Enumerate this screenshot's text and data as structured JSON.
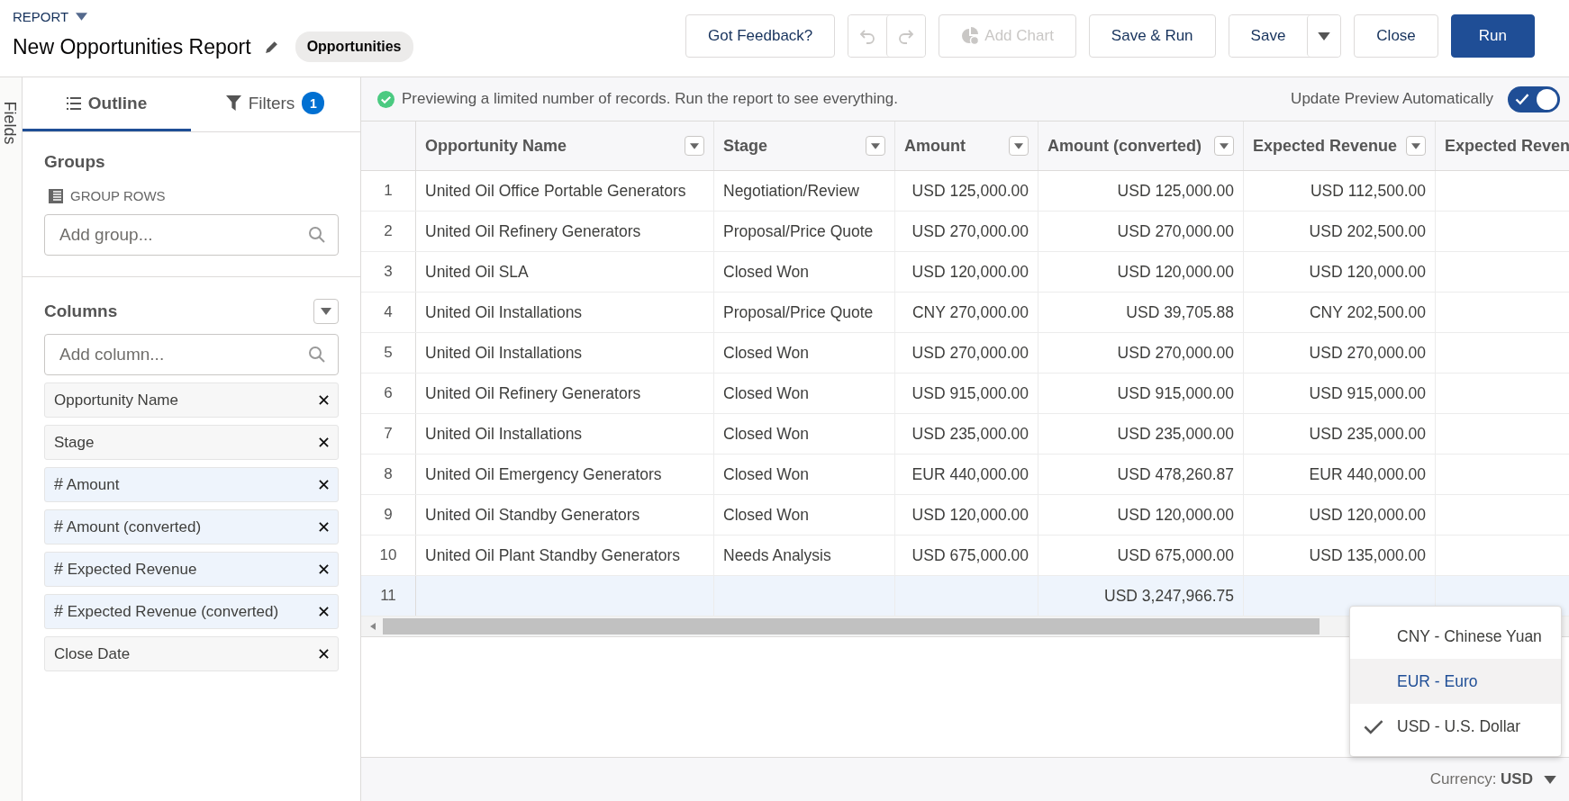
{
  "header": {
    "eyebrow": "REPORT",
    "title": "New Opportunities Report",
    "report_type": "Opportunities"
  },
  "toolbar": [
    {
      "kind": "button",
      "label": "Got Feedback?"
    },
    {
      "kind": "undo-redo",
      "disabled": true
    },
    {
      "kind": "chart",
      "label": "Add Chart",
      "disabled": true
    },
    {
      "kind": "button",
      "label": "Save & Run"
    },
    {
      "kind": "split",
      "label": "Save"
    },
    {
      "kind": "button",
      "label": "Close"
    },
    {
      "kind": "primary",
      "label": "Run"
    }
  ],
  "side_tab": "Fields",
  "panel_tabs": [
    {
      "label": "Outline",
      "selected": true
    },
    {
      "label": "Filters",
      "selected": false,
      "badge": "1"
    }
  ],
  "groups": {
    "heading": "Groups",
    "sublabel": "GROUP ROWS",
    "placeholder": "Add group..."
  },
  "columns_section": {
    "heading": "Columns",
    "placeholder": "Add column...",
    "items": [
      {
        "label": "Opportunity Name"
      },
      {
        "label": "Stage"
      },
      {
        "prefix": "#",
        "label": "Amount"
      },
      {
        "prefix": "#",
        "label": "Amount (converted)"
      },
      {
        "prefix": "#",
        "label": "Expected Revenue"
      },
      {
        "prefix": "#",
        "label": "Expected Revenue (converted)"
      },
      {
        "label": "Close Date"
      }
    ]
  },
  "preview": {
    "message": "Previewing a limited number of records. Run the report to see everything.",
    "toggle_label": "Update Preview Automatically",
    "auto_update": true
  },
  "table": {
    "columns": [
      {
        "label": "Opportunity Name"
      },
      {
        "label": "Stage"
      },
      {
        "label": "Amount"
      },
      {
        "label": "Amount (converted)"
      },
      {
        "label": "Expected Revenue"
      },
      {
        "label": "Expected Reven"
      }
    ],
    "rows": [
      {
        "number": "1",
        "total": false,
        "cells": [
          "United Oil Office Portable Generators",
          "Negotiation/Review",
          "USD 125,000.00",
          "USD 125,000.00",
          "USD 112,500.00",
          ""
        ]
      },
      {
        "number": "2",
        "total": false,
        "cells": [
          "United Oil Refinery Generators",
          "Proposal/Price Quote",
          "USD 270,000.00",
          "USD 270,000.00",
          "USD 202,500.00",
          ""
        ]
      },
      {
        "number": "3",
        "total": false,
        "cells": [
          "United Oil SLA",
          "Closed Won",
          "USD 120,000.00",
          "USD 120,000.00",
          "USD 120,000.00",
          ""
        ]
      },
      {
        "number": "4",
        "total": false,
        "cells": [
          "United Oil Installations",
          "Proposal/Price Quote",
          "CNY 270,000.00",
          "USD 39,705.88",
          "CNY 202,500.00",
          ""
        ]
      },
      {
        "number": "5",
        "total": false,
        "cells": [
          "United Oil Installations",
          "Closed Won",
          "USD 270,000.00",
          "USD 270,000.00",
          "USD 270,000.00",
          ""
        ]
      },
      {
        "number": "6",
        "total": false,
        "cells": [
          "United Oil Refinery Generators",
          "Closed Won",
          "USD 915,000.00",
          "USD 915,000.00",
          "USD 915,000.00",
          ""
        ]
      },
      {
        "number": "7",
        "total": false,
        "cells": [
          "United Oil Installations",
          "Closed Won",
          "USD 235,000.00",
          "USD 235,000.00",
          "USD 235,000.00",
          ""
        ]
      },
      {
        "number": "8",
        "total": false,
        "cells": [
          "United Oil Emergency Generators",
          "Closed Won",
          "EUR 440,000.00",
          "USD 478,260.87",
          "EUR 440,000.00",
          ""
        ]
      },
      {
        "number": "9",
        "total": false,
        "cells": [
          "United Oil Standby Generators",
          "Closed Won",
          "USD 120,000.00",
          "USD 120,000.00",
          "USD 120,000.00",
          ""
        ]
      },
      {
        "number": "10",
        "total": false,
        "cells": [
          "United Oil Plant Standby Generators",
          "Needs Analysis",
          "USD 675,000.00",
          "USD 675,000.00",
          "USD 135,000.00",
          ""
        ]
      },
      {
        "number": "11",
        "total": true,
        "cells": [
          "",
          "",
          "",
          "USD 3,247,966.75",
          "",
          ""
        ]
      }
    ]
  },
  "currency_menu": [
    {
      "label": "CNY - Chinese Yuan",
      "selected": false,
      "highlighted": false
    },
    {
      "label": "EUR - Euro",
      "selected": false,
      "highlighted": true
    },
    {
      "label": "USD - U.S. Dollar",
      "selected": true,
      "highlighted": false
    }
  ],
  "footer": {
    "currency": "Currency: **USD**"
  }
}
